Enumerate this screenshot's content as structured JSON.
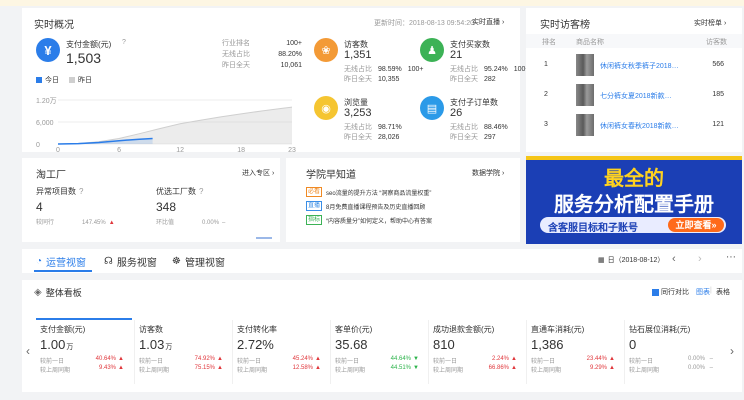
{
  "top_strip_color": "#fdf6e3",
  "realtime": {
    "title": "实时概况",
    "updated": "更新时间：2018-08-13 09:54:20",
    "link": "实时直播",
    "pay_amount": {
      "label": "支付金额(元)",
      "value": "1,503",
      "rows": [
        {
          "label": "行业排名",
          "value": "100+"
        },
        {
          "label": "无线占比",
          "value": "88.20%"
        },
        {
          "label": "昨日全天",
          "value": "10,061"
        }
      ]
    },
    "legend": {
      "today": "今日",
      "yesterday": "昨日"
    },
    "chart_data": {
      "type": "area",
      "y_ticks": [
        "1.20万",
        "6,000",
        "0"
      ],
      "x_ticks": [
        "0",
        "6",
        "12",
        "18",
        "23"
      ],
      "series": [
        {
          "name": "今日",
          "points": [
            [
              0,
              0
            ],
            [
              2,
              100
            ],
            [
              4,
              400
            ],
            [
              6,
              900
            ],
            [
              8,
              1300
            ],
            [
              9.3,
              1503
            ]
          ]
        },
        {
          "name": "昨日",
          "points": [
            [
              0,
              0
            ],
            [
              2,
              150
            ],
            [
              4,
              600
            ],
            [
              6,
              1500
            ],
            [
              8,
              2800
            ],
            [
              10,
              4200
            ],
            [
              12,
              5500
            ],
            [
              14,
              6500
            ],
            [
              16,
              7400
            ],
            [
              18,
              8200
            ],
            [
              20,
              9000
            ],
            [
              22,
              9700
            ],
            [
              23,
              10061
            ]
          ]
        }
      ],
      "ylim": [
        0,
        12000
      ],
      "xlim": [
        0,
        23
      ]
    },
    "metrics": [
      {
        "label": "访客数",
        "value": "1,351",
        "icon": "footprint-icon",
        "color": "#f39a36",
        "rows": [
          {
            "label": "无线占比",
            "value": "98.59%",
            "extra": "100+"
          },
          {
            "label": "昨日全天",
            "value": "10,355"
          }
        ]
      },
      {
        "label": "支付买家数",
        "value": "21",
        "icon": "buyer-icon",
        "color": "#3cb256",
        "rows": [
          {
            "label": "无线占比",
            "value": "95.24%",
            "extra": "100+"
          },
          {
            "label": "昨日全天",
            "value": "282"
          }
        ]
      },
      {
        "label": "浏览量",
        "value": "3,253",
        "icon": "eye-icon",
        "color": "#f5c531",
        "rows": [
          {
            "label": "无线占比",
            "value": "98.71%"
          },
          {
            "label": "昨日全天",
            "value": "28,026"
          }
        ]
      },
      {
        "label": "支付子订单数",
        "value": "26",
        "icon": "order-icon",
        "color": "#2b9ae8",
        "rows": [
          {
            "label": "无线占比",
            "value": "88.46%"
          },
          {
            "label": "昨日全天",
            "value": "297"
          }
        ]
      }
    ]
  },
  "visitors": {
    "title": "实时访客榜",
    "link": "实时榜单",
    "headers": [
      "排名",
      "商品名称",
      "访客数"
    ],
    "rows": [
      {
        "rank": "1",
        "name": "休闲裤女秋季裤子2018…",
        "count": "566"
      },
      {
        "rank": "2",
        "name": "七分裤女夏2018新款…",
        "count": "185"
      },
      {
        "rank": "3",
        "name": "休闲裤女春秋2018新款…",
        "count": "121"
      }
    ]
  },
  "factory": {
    "title": "淘工厂",
    "link": "进入专区",
    "items": [
      {
        "label": "异常项目数",
        "value": "4",
        "sub_label": "较同行",
        "sub_value": "147.45%"
      },
      {
        "label": "优选工厂数",
        "value": "348",
        "sub_label": "环比值",
        "sub_value": "0.00%"
      }
    ]
  },
  "academy": {
    "title": "学院早知道",
    "link": "数据学院",
    "items": [
      {
        "tag": "必看",
        "tag_color": "#f08a24",
        "text": "seo流量的提升方法 “洞察商品流量权重”"
      },
      {
        "tag": "直播",
        "tag_color": "#3a8ee6",
        "text": "8月免费直播课程预告及历史直播回顾"
      },
      {
        "tag": "指标",
        "tag_color": "#3cb256",
        "text": "“内容质量分”如何定义，帮助中心有答案"
      }
    ]
  },
  "banner": {
    "line1": "最全的",
    "line2": "服务分析配置手册",
    "line3": "含客服目标和子账号",
    "button": "立即查看»"
  },
  "tabs": {
    "items": [
      "运营视窗",
      "服务视窗",
      "管理视窗"
    ],
    "date": "日（2018-08-12）"
  },
  "dashboard": {
    "title": "整体看板",
    "compare": "同行对比",
    "view_chart": "图表",
    "view_table": "表格",
    "metrics": [
      {
        "label": "支付金额(元)",
        "value": "1.00",
        "unit": "万",
        "r1": "40.64%",
        "r1dir": "up",
        "r2": "9.43%",
        "r2dir": "up"
      },
      {
        "label": "访客数",
        "value": "1.03",
        "unit": "万",
        "r1": "74.92%",
        "r1dir": "up",
        "r2": "75.15%",
        "r2dir": "up"
      },
      {
        "label": "支付转化率",
        "value": "2.72%",
        "unit": "",
        "r1": "45.24%",
        "r1dir": "up",
        "r2": "12.58%",
        "r2dir": "up"
      },
      {
        "label": "客单价(元)",
        "value": "35.68",
        "unit": "",
        "r1": "44.64%",
        "r1dir": "down",
        "r2": "44.51%",
        "r2dir": "down"
      },
      {
        "label": "成功退款金额(元)",
        "value": "810",
        "unit": "",
        "r1": "2.24%",
        "r1dir": "up",
        "r2": "66.86%",
        "r2dir": "up"
      },
      {
        "label": "直通车消耗(元)",
        "value": "1,386",
        "unit": "",
        "r1": "23.44%",
        "r1dir": "up",
        "r2": "9.29%",
        "r2dir": "up"
      },
      {
        "label": "钻石展位消耗(元)",
        "value": "0",
        "unit": "",
        "r1": "0.00%",
        "r1dir": "none",
        "r2": "0.00%",
        "r2dir": "none"
      }
    ],
    "compare_labels": {
      "r1": "较前一日",
      "r2": "较上周同期"
    }
  },
  "bottom": {
    "items": [
      "",
      ""
    ]
  }
}
